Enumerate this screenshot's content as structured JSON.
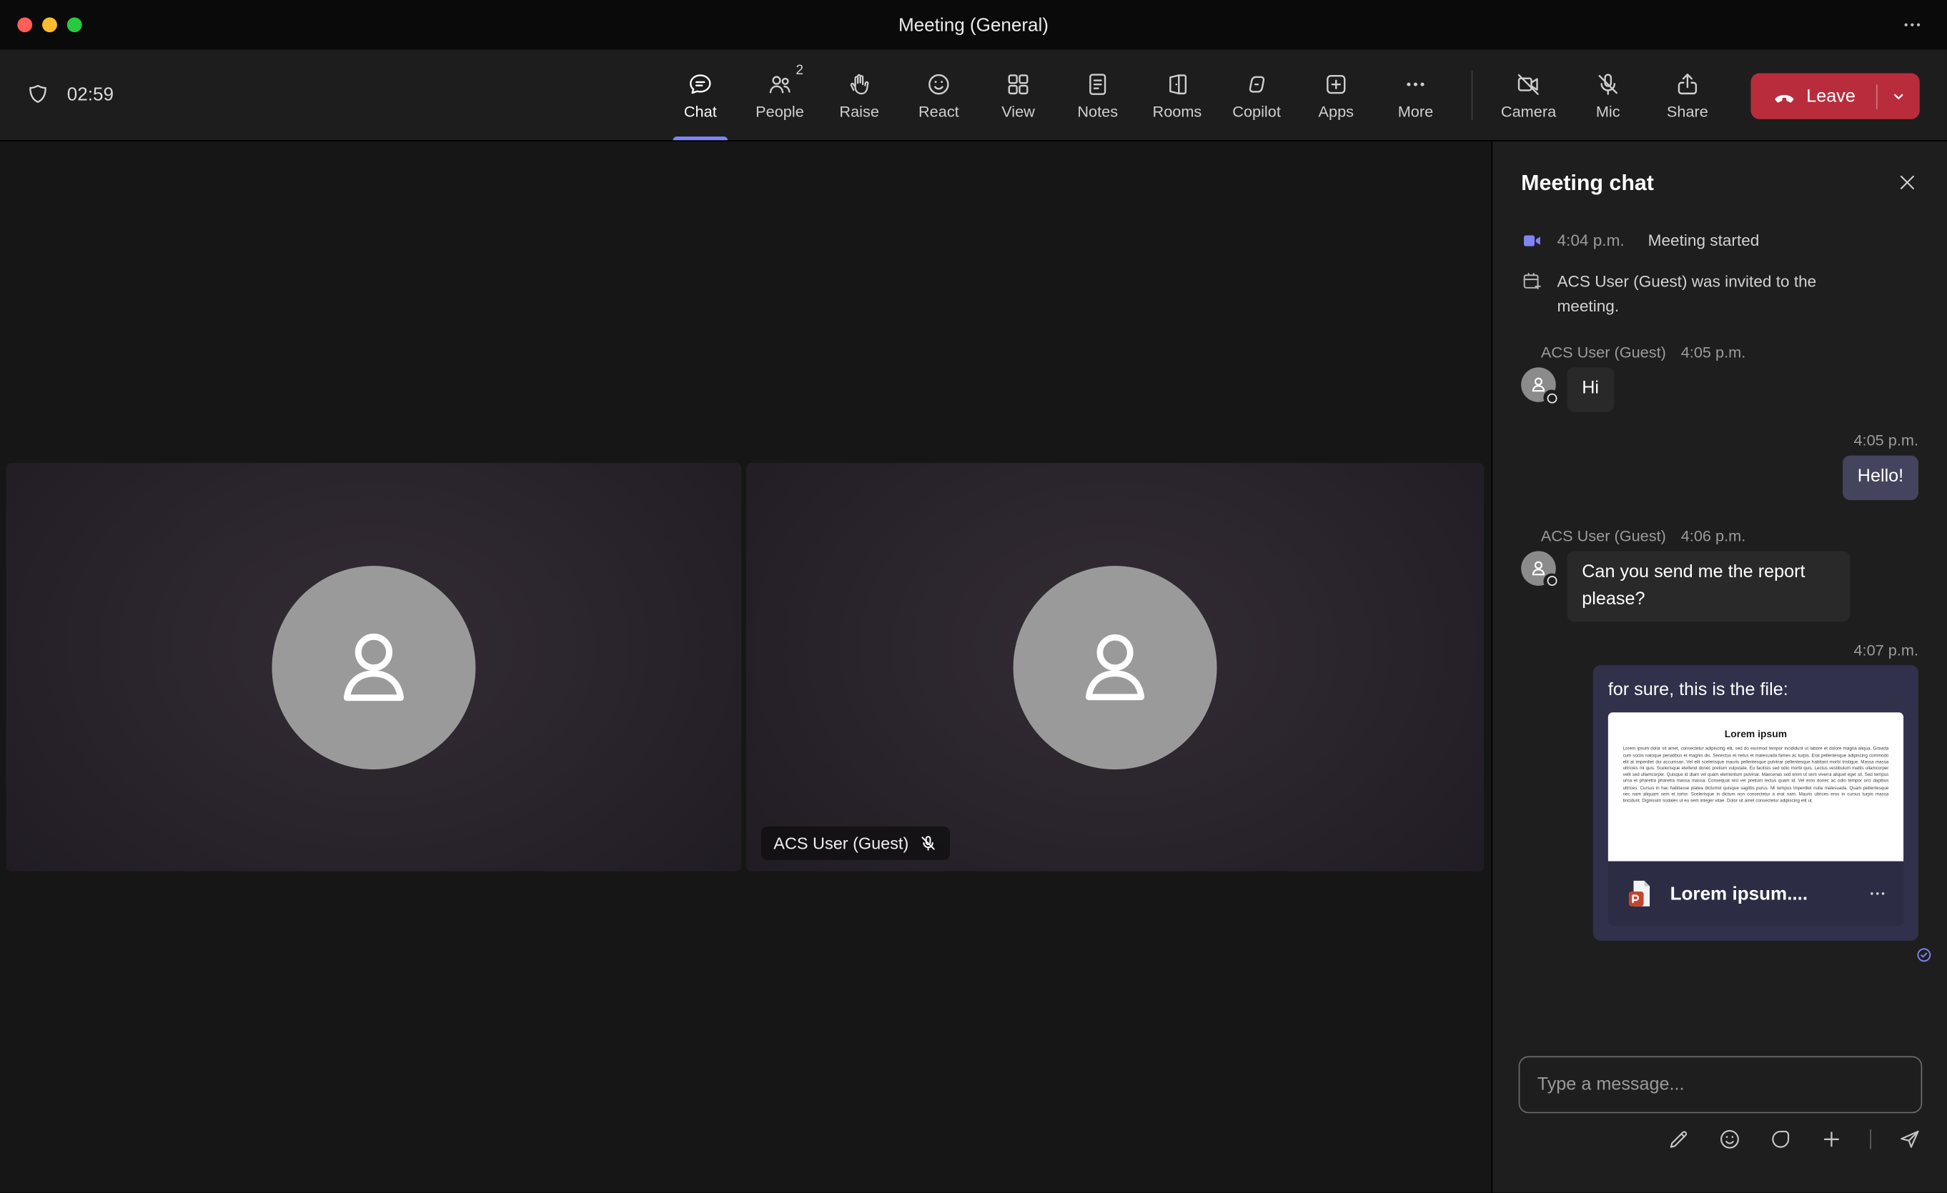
{
  "window": {
    "title": "Meeting (General)"
  },
  "toolbar": {
    "timer": "02:59",
    "tabs": [
      {
        "label": "Chat",
        "active": true
      },
      {
        "label": "People",
        "badge": "2"
      },
      {
        "label": "Raise"
      },
      {
        "label": "React"
      },
      {
        "label": "View"
      },
      {
        "label": "Notes"
      },
      {
        "label": "Rooms"
      },
      {
        "label": "Copilot"
      },
      {
        "label": "Apps"
      },
      {
        "label": "More"
      }
    ],
    "devices": [
      {
        "label": "Camera",
        "muted": true
      },
      {
        "label": "Mic",
        "muted": true
      },
      {
        "label": "Share"
      }
    ],
    "leave_label": "Leave"
  },
  "stage": {
    "tiles": [
      {
        "id": "participant-1"
      },
      {
        "id": "participant-2",
        "name_tag": "ACS User (Guest)",
        "muted": true
      }
    ]
  },
  "chat": {
    "title": "Meeting chat",
    "events": [
      {
        "time": "4:04 p.m.",
        "text": "Meeting started"
      },
      {
        "text": "ACS User (Guest) was invited to the meeting."
      }
    ],
    "messages": [
      {
        "direction": "incoming",
        "author": "ACS User (Guest)",
        "time": "4:05 p.m.",
        "text": "Hi"
      },
      {
        "direction": "outgoing",
        "time": "4:05 p.m.",
        "text": "Hello!"
      },
      {
        "direction": "incoming",
        "author": "ACS User (Guest)",
        "time": "4:06 p.m.",
        "text": "Can you send me the report please?"
      },
      {
        "direction": "outgoing",
        "time": "4:07 p.m.",
        "text": "for sure, this is the file:",
        "attachment": {
          "preview_title": "Lorem ipsum",
          "preview_body": "Lorem ipsum dolor sit amet, consectetur adipiscing elit, sed do eiusmod tempor incididunt ut labore et dolore magna aliqua. Gravida cum sociis natoque penatibus et magnis dis. Senectus et netus et malesuada fames ac turpis. Erat pellentesque adipiscing commodo elit at imperdiet dui accumsan. Vel elit scelerisque mauris pellentesque pulvinar pellentesque habitant morbi tristique. Massa massa ultricies mi quis. Scelerisque eleifend donec pretium vulputate. Eu facilisis sed odio morbi quis. Lectus vestibulum mattis ullamcorper velit sed ullamcorper. Quisque id diam vel quam elementum pulvinar. Maecenas sed enim ut sem viverra aliquet eget sit. Sed tempus urna et pharetra pharetra massa massa. Consequat nisl vel pretium lectus quam id. Vel eros donec ac odio tempor orci dapibus ultrices. Cursus in hac habitasse platea dictumst quisque sagittis purus. Mi tempus imperdiet nulla malesuada. Quam pellentesque nec nam aliquam sem et tortor. Scelerisque in dictum non consectetur a erat nam. Mauris ultrices eros in cursus turpis massa tincidunt. Dignissim sodales ut eu sem integer vitae. Dolor sit amet consectetur adipiscing elit ut.",
          "file_name": "Lorem ipsum...."
        }
      }
    ],
    "composer": {
      "placeholder": "Type a message..."
    }
  },
  "colors": {
    "accent": "#7f85f5",
    "leave_red": "#b92c3c",
    "incoming_bubble": "#292929",
    "outgoing_bubble": "#44445f",
    "outgoing_card": "#31314c",
    "file_icon": "#c6442c"
  }
}
